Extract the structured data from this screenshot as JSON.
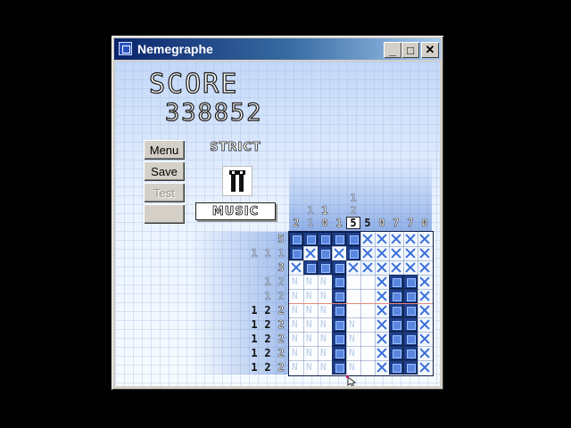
{
  "window": {
    "title": "Nemegraphe",
    "buttons": {
      "minimize": "_",
      "maximize": "□",
      "close": "✕"
    }
  },
  "score": {
    "label": "SCORE",
    "value": "338852"
  },
  "menu": {
    "menu_label": "Menu",
    "save_label": "Save",
    "test_label": "Test",
    "blank_label": ""
  },
  "modes": {
    "strict_label": "STRICT",
    "music_label": "MUSIC"
  },
  "colors": {
    "filled": "#1e3f8c",
    "cross": "#3a6fd8",
    "background": "#e9f2fe",
    "title_start": "#0a246a"
  },
  "puzzle": {
    "size": 10,
    "column_clues": [
      [
        {
          "v": "2",
          "s": "light"
        }
      ],
      [
        {
          "v": "1",
          "s": "done"
        },
        {
          "v": "1",
          "s": "done"
        }
      ],
      [
        {
          "v": "1",
          "s": "light"
        },
        {
          "v": "0",
          "s": "light"
        }
      ],
      [
        {
          "v": "1",
          "s": "light"
        }
      ],
      [
        {
          "v": "1",
          "s": "done"
        },
        {
          "v": "2",
          "s": "done"
        },
        {
          "v": "5",
          "s": "boxed"
        }
      ],
      [
        {
          "v": "5",
          "s": "dark"
        }
      ],
      [
        {
          "v": "0",
          "s": "light"
        }
      ],
      [
        {
          "v": "7",
          "s": "light"
        }
      ],
      [
        {
          "v": "7",
          "s": "light"
        }
      ],
      [
        {
          "v": "0",
          "s": "light"
        }
      ]
    ],
    "row_clues": [
      [
        {
          "v": "5",
          "s": "light"
        }
      ],
      [
        {
          "v": "1",
          "s": "done"
        },
        {
          "v": "1",
          "s": "done"
        },
        {
          "v": "1",
          "s": "done"
        }
      ],
      [
        {
          "v": "3",
          "s": "light"
        }
      ],
      [
        {
          "v": "1",
          "s": "done"
        },
        {
          "v": "2",
          "s": "done"
        }
      ],
      [
        {
          "v": "1",
          "s": "done"
        },
        {
          "v": "2",
          "s": "done"
        }
      ],
      [
        {
          "v": "1",
          "s": "dark"
        },
        {
          "v": "2",
          "s": "dark"
        },
        {
          "v": "2",
          "s": "light"
        }
      ],
      [
        {
          "v": "1",
          "s": "dark"
        },
        {
          "v": "2",
          "s": "dark"
        },
        {
          "v": "2",
          "s": "light"
        }
      ],
      [
        {
          "v": "1",
          "s": "dark"
        },
        {
          "v": "2",
          "s": "dark"
        },
        {
          "v": "2",
          "s": "light"
        }
      ],
      [
        {
          "v": "1",
          "s": "dark"
        },
        {
          "v": "2",
          "s": "dark"
        },
        {
          "v": "2",
          "s": "light"
        }
      ],
      [
        {
          "v": "1",
          "s": "dark"
        },
        {
          "v": "2",
          "s": "dark"
        },
        {
          "v": "2",
          "s": "light"
        }
      ]
    ],
    "cells": [
      "FFFFFXXXXX",
      "FXFXFXXXXX",
      "XFFFXXXXXX",
      "NNNF..XFFX",
      "NNNF..XFFX",
      "NNNF..XFFX",
      "NNNFN.XFFX",
      "NNNFN.XFFX",
      "NNNFN.XFFX",
      "NNNFN.XFFX"
    ]
  }
}
